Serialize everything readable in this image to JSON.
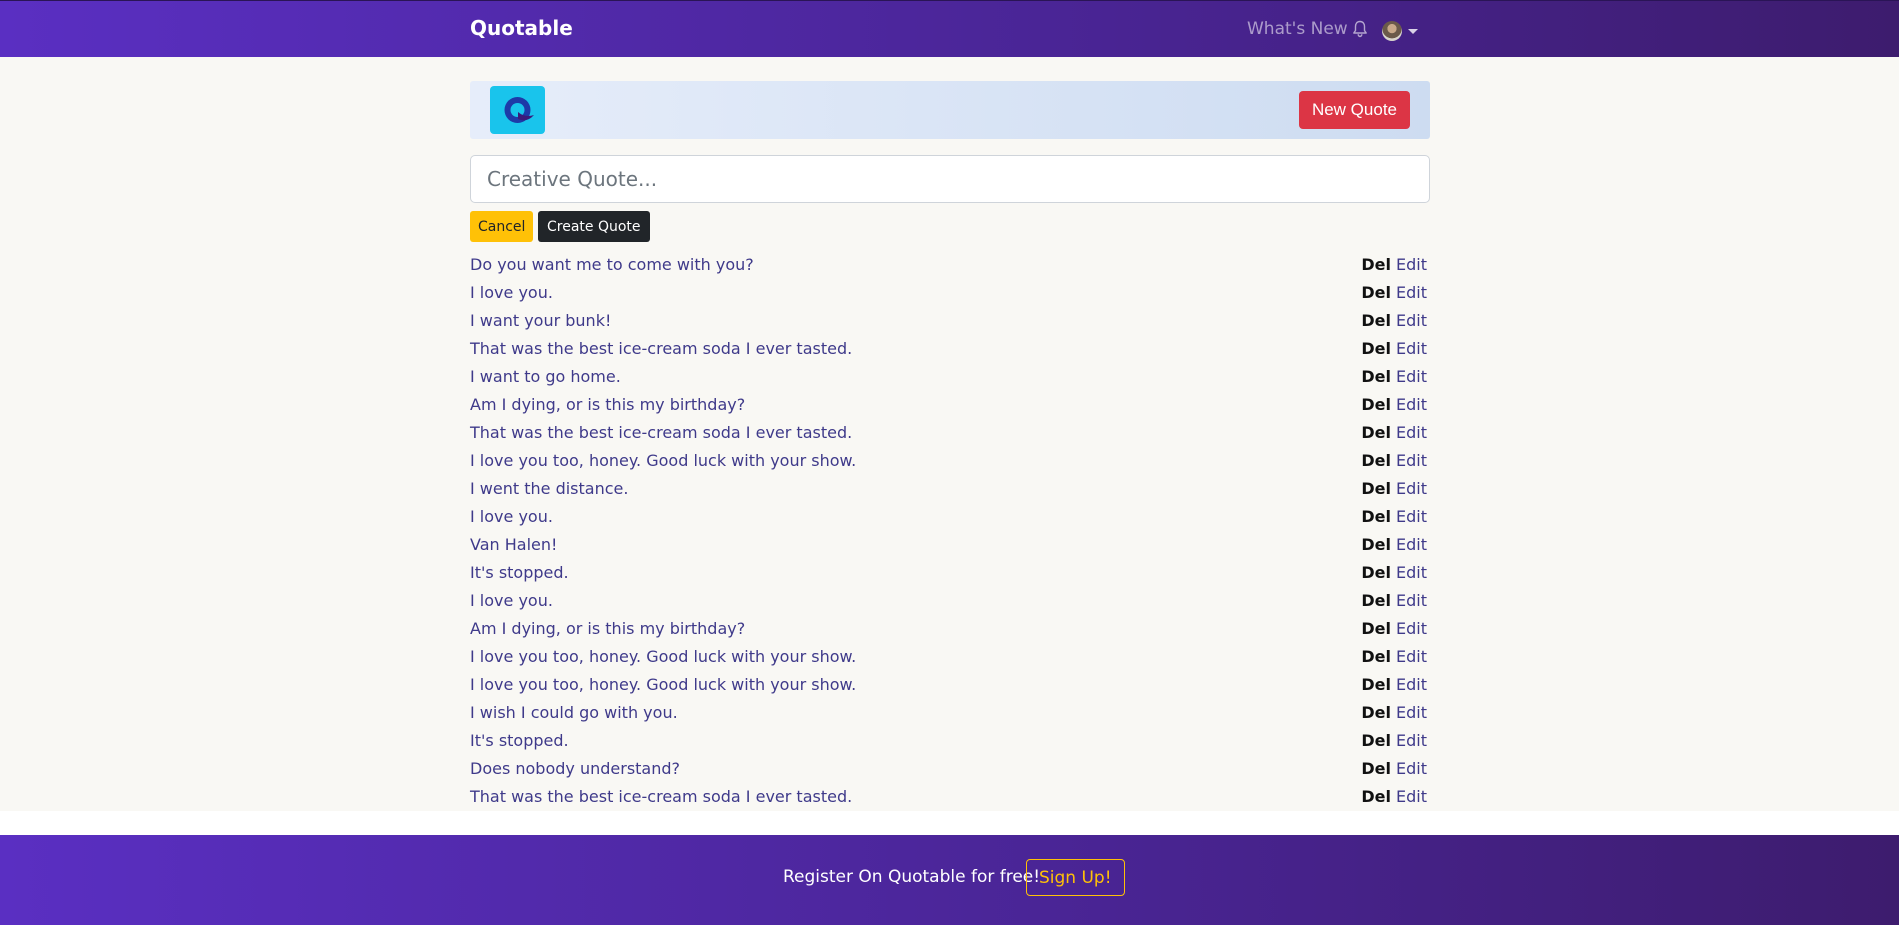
{
  "navbar": {
    "brand": "Quotable",
    "whats_new": "What's New",
    "bell_icon": "bell-icon",
    "avatar_icon": "user-avatar",
    "caret_icon": "caret-down-icon"
  },
  "header": {
    "logo_icon": "quotable-q-logo",
    "new_quote_label": "New Quote"
  },
  "form": {
    "placeholder": "Creative Quote...",
    "cancel_label": "Cancel",
    "create_label": "Create Quote"
  },
  "quotes": [
    {
      "text": "Do you want me to come with you?",
      "del": "Del",
      "edit": "Edit"
    },
    {
      "text": "I love you.",
      "del": "Del",
      "edit": "Edit"
    },
    {
      "text": "I want your bunk!",
      "del": "Del",
      "edit": "Edit"
    },
    {
      "text": "That was the best ice-cream soda I ever tasted.",
      "del": "Del",
      "edit": "Edit"
    },
    {
      "text": "I want to go home.",
      "del": "Del",
      "edit": "Edit"
    },
    {
      "text": "Am I dying, or is this my birthday?",
      "del": "Del",
      "edit": "Edit"
    },
    {
      "text": "That was the best ice-cream soda I ever tasted.",
      "del": "Del",
      "edit": "Edit"
    },
    {
      "text": "I love you too, honey. Good luck with your show.",
      "del": "Del",
      "edit": "Edit"
    },
    {
      "text": "I went the distance.",
      "del": "Del",
      "edit": "Edit"
    },
    {
      "text": "I love you.",
      "del": "Del",
      "edit": "Edit"
    },
    {
      "text": "Van Halen!",
      "del": "Del",
      "edit": "Edit"
    },
    {
      "text": "It's stopped.",
      "del": "Del",
      "edit": "Edit"
    },
    {
      "text": "I love you.",
      "del": "Del",
      "edit": "Edit"
    },
    {
      "text": "Am I dying, or is this my birthday?",
      "del": "Del",
      "edit": "Edit"
    },
    {
      "text": "I love you too, honey. Good luck with your show.",
      "del": "Del",
      "edit": "Edit"
    },
    {
      "text": "I love you too, honey. Good luck with your show.",
      "del": "Del",
      "edit": "Edit"
    },
    {
      "text": "I wish I could go with you.",
      "del": "Del",
      "edit": "Edit"
    },
    {
      "text": "It's stopped.",
      "del": "Del",
      "edit": "Edit"
    },
    {
      "text": "Does nobody understand?",
      "del": "Del",
      "edit": "Edit"
    },
    {
      "text": "That was the best ice-cream soda I ever tasted.",
      "del": "Del",
      "edit": "Edit"
    }
  ],
  "footer": {
    "text": "Register On Quotable for free!",
    "signup_label": "Sign Up!"
  },
  "colors": {
    "brand_gradient_start": "#5a2fc2",
    "brand_gradient_end": "#3d1c6e",
    "danger": "#dc3545",
    "warning": "#ffc107",
    "dark": "#212529",
    "link": "#3f3a8a",
    "logo_bg": "#19c4ec"
  }
}
